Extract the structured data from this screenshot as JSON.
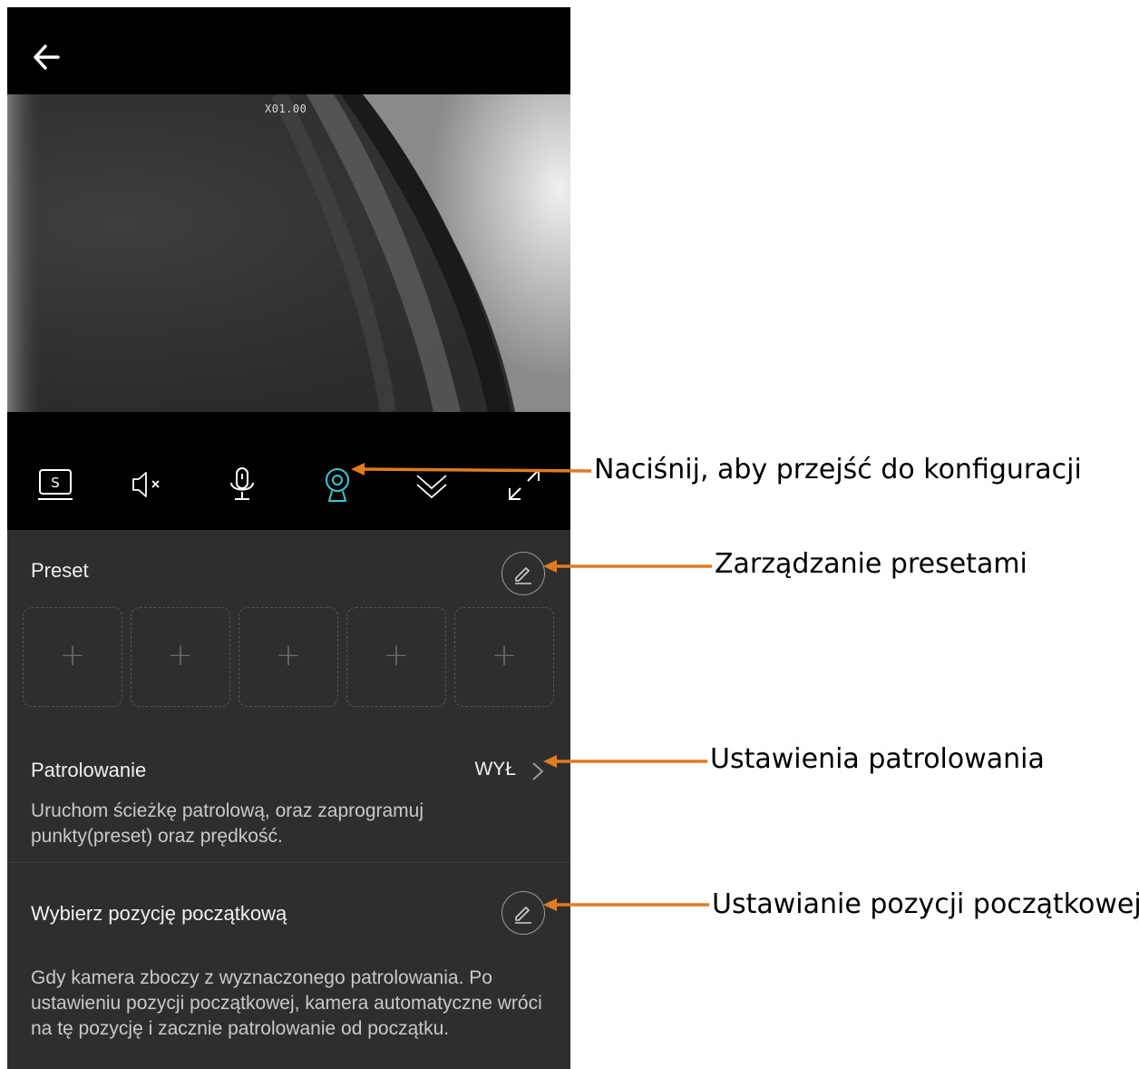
{
  "video": {
    "zoom_label": "X01.00"
  },
  "controls": [
    {
      "name": "screenshot-icon"
    },
    {
      "name": "mute-icon"
    },
    {
      "name": "microphone-icon"
    },
    {
      "name": "ptz-camera-icon",
      "active": true,
      "color": "#3ec6d6"
    },
    {
      "name": "collapse-icon"
    },
    {
      "name": "fullscreen-icon"
    }
  ],
  "preset": {
    "title": "Preset",
    "slots": [
      "+",
      "+",
      "+",
      "+",
      "+"
    ]
  },
  "patrol": {
    "title": "Patrolowanie",
    "value": "WYŁ",
    "description": "Uruchom ścieżkę patrolową, oraz zaprogramuj punkty(preset) oraz prędkość."
  },
  "home_position": {
    "title": "Wybierz pozycję początkową",
    "description": "Gdy kamera zboczy z wyznaczonego patrolowania. Po ustawieniu pozycji początkowej, kamera automatyczne wróci na tę pozycję i zacznie patrolowanie od początku."
  },
  "annotations": {
    "config": "Naciśnij, aby przejść do konfiguracji",
    "presets": "Zarządzanie presetami",
    "patrol": "Ustawienia patrolowania",
    "home": "Ustawianie pozycji początkowej"
  },
  "colors": {
    "accent": "#3ec6d6",
    "annotation_arrow": "#e07b22",
    "panel_bg": "#2e2e2e",
    "bar_bg": "#000000"
  }
}
